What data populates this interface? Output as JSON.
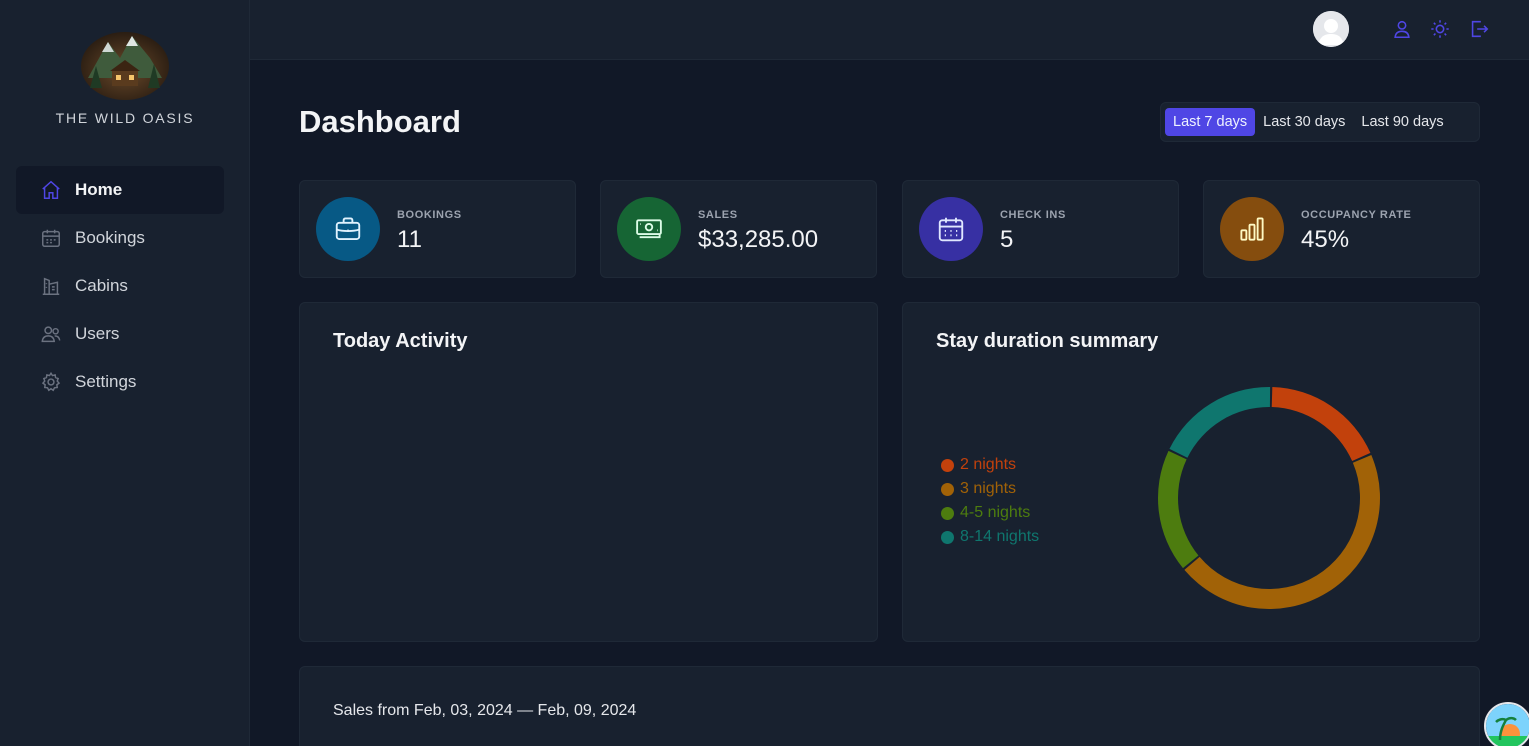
{
  "brand": {
    "name": "THE WILD OASIS"
  },
  "sidebar": {
    "items": [
      {
        "label": "Home",
        "icon": "home-icon",
        "active": true
      },
      {
        "label": "Bookings",
        "icon": "calendar-icon",
        "active": false
      },
      {
        "label": "Cabins",
        "icon": "building-icon",
        "active": false
      },
      {
        "label": "Users",
        "icon": "users-icon",
        "active": false
      },
      {
        "label": "Settings",
        "icon": "gear-icon",
        "active": false
      }
    ]
  },
  "header": {
    "icons": [
      "user-icon",
      "sun-icon",
      "logout-icon"
    ]
  },
  "page": {
    "title": "Dashboard"
  },
  "filter": {
    "options": [
      "Last 7 days",
      "Last 30 days",
      "Last 90 days"
    ],
    "selected": "Last 7 days"
  },
  "stats": [
    {
      "title": "BOOKINGS",
      "value": "11",
      "icon": "briefcase-icon",
      "color": "#075985"
    },
    {
      "title": "SALES",
      "value": "$33,285.00",
      "icon": "banknotes-icon",
      "color": "#166534"
    },
    {
      "title": "CHECK INS",
      "value": "5",
      "icon": "calendar-days-icon",
      "color": "#3730a3"
    },
    {
      "title": "OCCUPANCY RATE",
      "value": "45%",
      "icon": "chart-bar-icon",
      "color": "#854d0e"
    }
  ],
  "today": {
    "title": "Today Activity"
  },
  "stay": {
    "title": "Stay duration summary",
    "legend": [
      {
        "label": "2 nights",
        "color": "#c2410c"
      },
      {
        "label": "3 nights",
        "color": "#a16207"
      },
      {
        "label": "4-5 nights",
        "color": "#4d7c0f"
      },
      {
        "label": "8-14 nights",
        "color": "#0f766e"
      }
    ]
  },
  "chart_data": {
    "type": "pie",
    "categories": [
      "2 nights",
      "3 nights",
      "4-5 nights",
      "8-14 nights"
    ],
    "values": [
      2,
      5,
      2,
      2
    ]
  },
  "sales": {
    "title": "Sales from Feb, 03, 2024 — Feb, 09, 2024"
  }
}
